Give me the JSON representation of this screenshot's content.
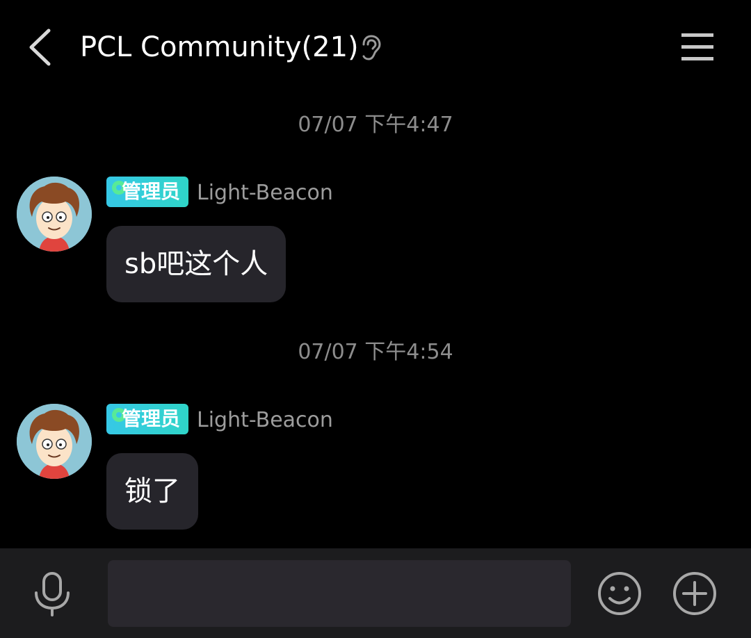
{
  "header": {
    "title": "PCL Community(21)",
    "back_icon": "chevron-left-icon",
    "ear_icon": "ear-icon",
    "menu_icon": "hamburger-menu-icon"
  },
  "messages": [
    {
      "timestamp": "07/07 下午4:47",
      "badge": "管理员",
      "sender": "Light-Beacon",
      "text": "sb吧这个人"
    },
    {
      "timestamp": "07/07 下午4:54",
      "badge": "管理员",
      "sender": "Light-Beacon",
      "text": "锁了"
    }
  ],
  "bottom_bar": {
    "mic_icon": "microphone-icon",
    "input_value": "",
    "emoji_icon": "smiley-icon",
    "plus_icon": "plus-circle-icon"
  },
  "colors": {
    "background": "#000000",
    "bubble": "#26252b",
    "bottom_bar": "#1c1c1e",
    "input": "#2a282e",
    "badge_gradient_start": "#36c8e6",
    "badge_gradient_end": "#2fd5c8",
    "muted_text": "#8d8d8d"
  }
}
